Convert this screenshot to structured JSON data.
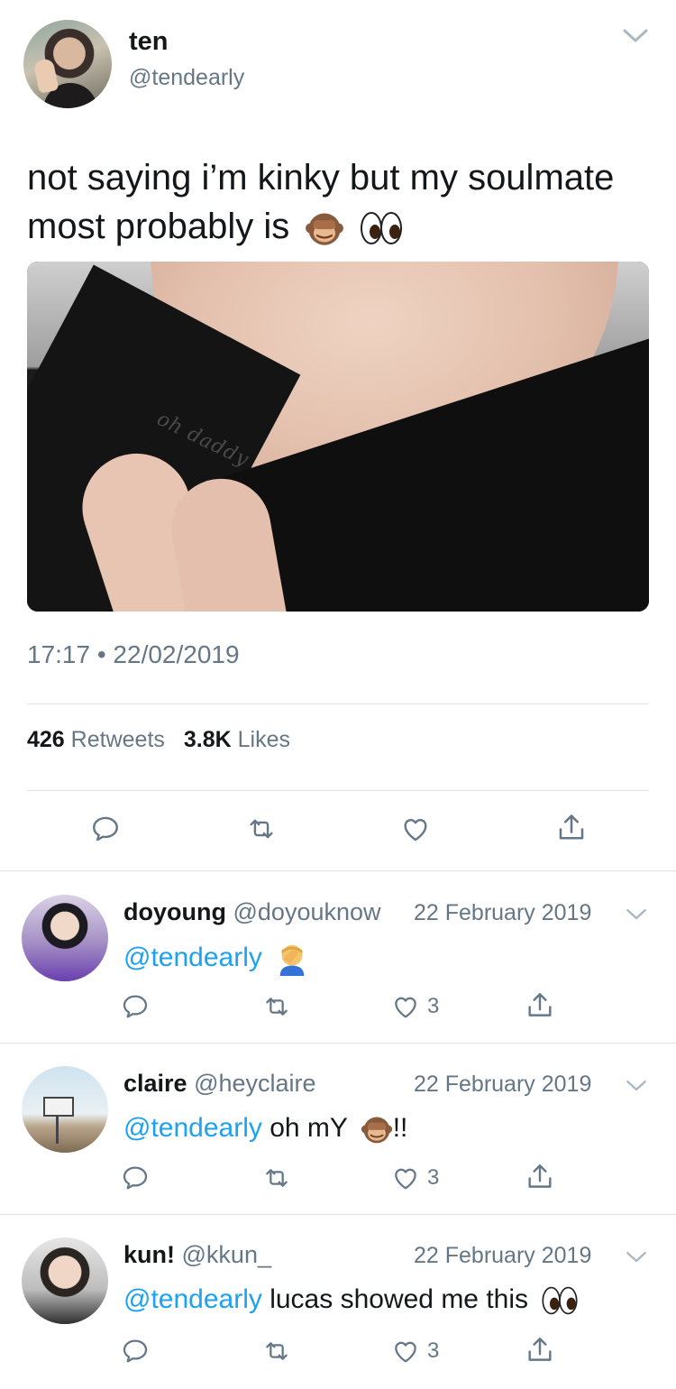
{
  "main_tweet": {
    "display_name": "ten",
    "handle": "@tendearly",
    "text": "not saying i’m kinky but my soulmate most probably is",
    "emojis": [
      "see-no-evil-monkey-emoji",
      "eyes-emoji"
    ],
    "image_caption_tattoo": "oh daddy",
    "timestamp": "17:17 • 22/02/2019",
    "retweets_count": "426",
    "retweets_label": "Retweets",
    "likes_count": "3.8K",
    "likes_label": "Likes"
  },
  "replies": [
    {
      "display_name": "doyoung",
      "handle": "@doyouknow",
      "date": "22 February 2019",
      "mention": "@tendearly",
      "text": "",
      "emoji": "facepalm-emoji",
      "like_count": "3"
    },
    {
      "display_name": "claire",
      "handle": "@heyclaire",
      "date": "22 February 2019",
      "mention": "@tendearly",
      "text": " oh mY ",
      "emoji": "see-no-evil-monkey-emoji",
      "text_after": "!!",
      "like_count": "3"
    },
    {
      "display_name": "kun!",
      "handle": "@kkun_",
      "date": "22 February 2019",
      "mention": "@tendearly",
      "text": " lucas showed me this ",
      "emoji": "eyes-emoji",
      "like_count": "3"
    }
  ],
  "colors": {
    "link": "#1da1f2",
    "secondary_text": "#657786",
    "divider": "#dfe3e7",
    "primary_text": "#14171a"
  }
}
